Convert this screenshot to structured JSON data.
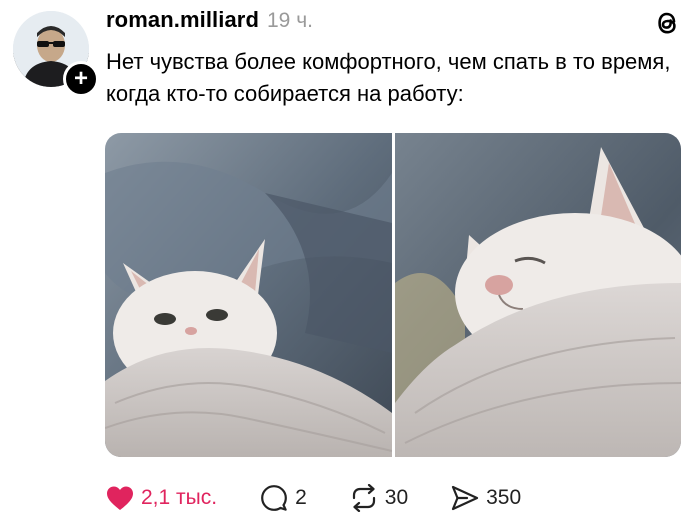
{
  "post": {
    "username": "roman.milliard",
    "timestamp": "19 ч.",
    "text": "Нет чувства более комфортного, чем спать в то время, когда кто-то собирается на работу:",
    "follow_symbol": "+"
  },
  "media": {
    "images": [
      {
        "description_icon": "cat-peeking-photo"
      },
      {
        "description_icon": "cat-sleeping-photo"
      }
    ]
  },
  "actions": {
    "likes": "2,1 тыс.",
    "replies": "2",
    "reposts": "30",
    "shares": "350"
  },
  "colors": {
    "like": "#e0245e",
    "muted": "#9a9a9a",
    "text": "#000000"
  }
}
